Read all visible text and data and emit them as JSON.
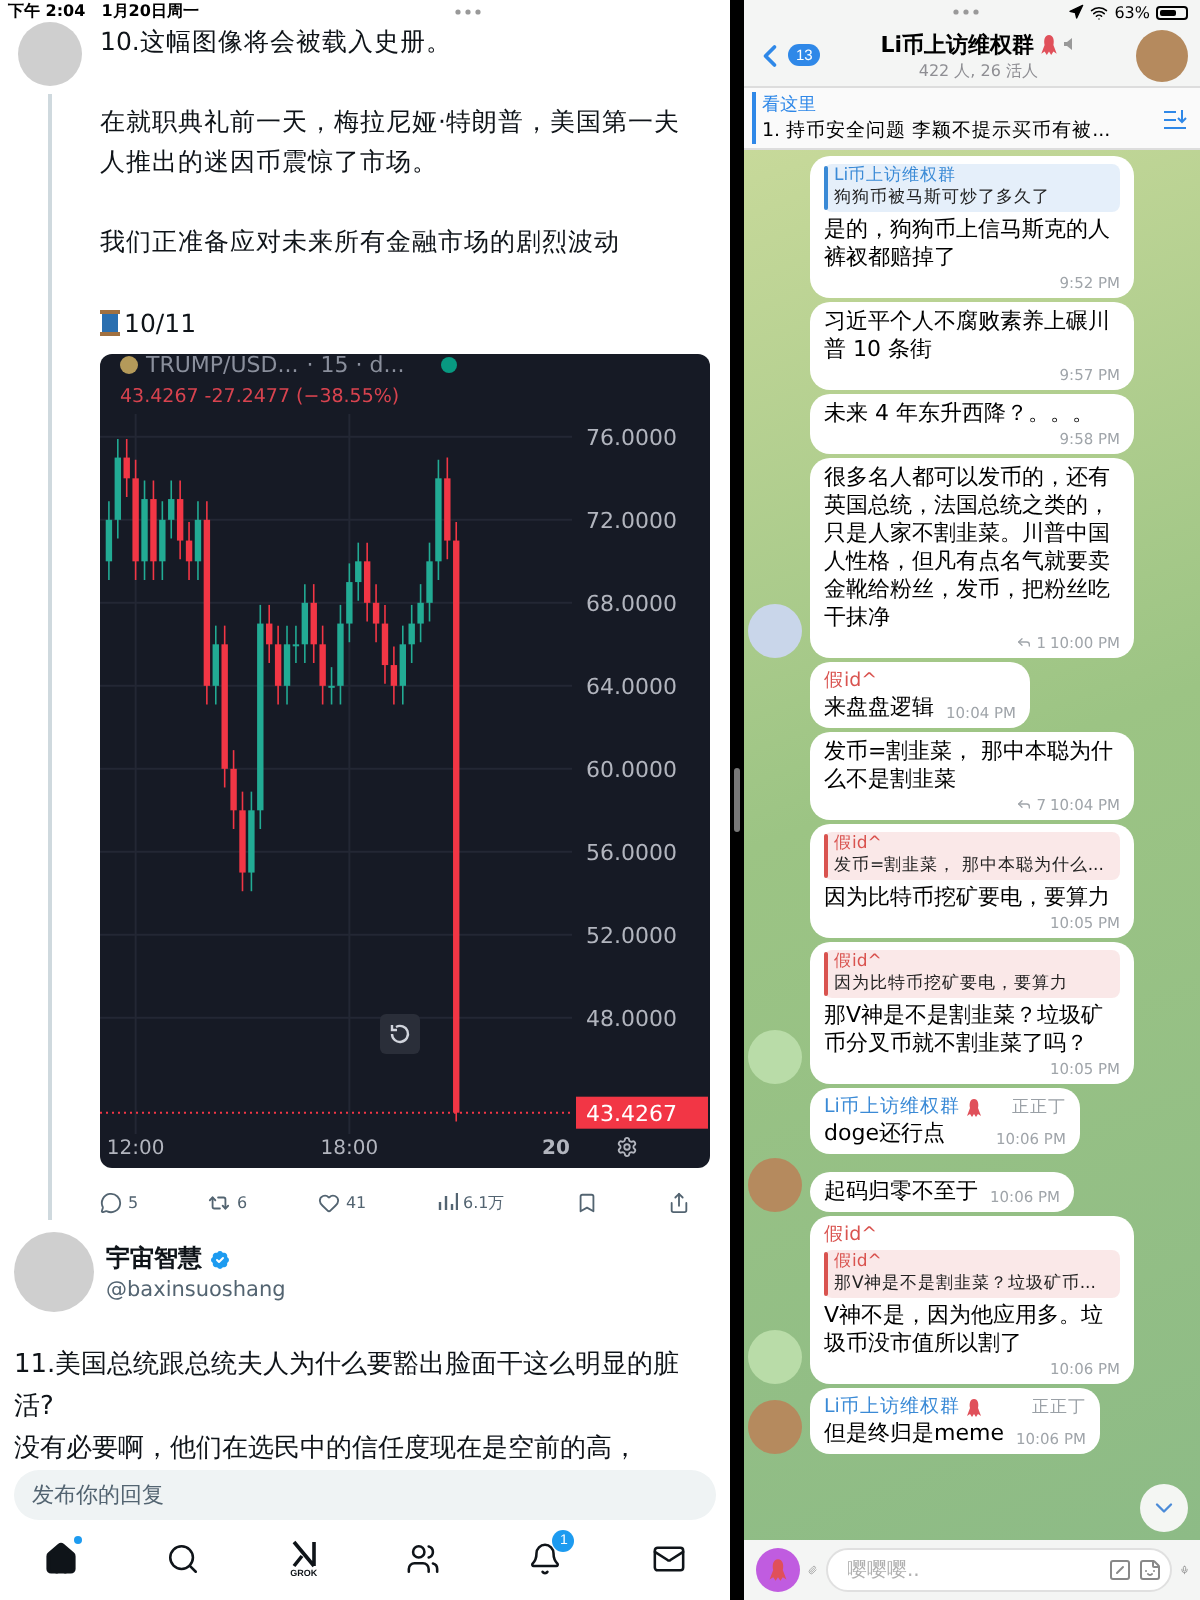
{
  "status_bar": {
    "time": "下午 2:04",
    "date": "1月20日周一",
    "battery": "63%"
  },
  "tweet": {
    "paragraphs": [
      "10.这幅图像将会被载入史册。",
      "在就职典礼前一天，梅拉尼娅·特朗普，美国第一夫人推出的迷因币震惊了市场。",
      "我们正准备应对未来所有金融市场的剧烈波动"
    ],
    "thread_counter": "10/11",
    "price_chart": {
      "symbol": "TRUMP/USD...",
      "interval": "· 15 · d...",
      "quote": "43.4267  -27.2477 (−38.55%)",
      "last_price": "43.4267",
      "date_label": "20",
      "chart_data": {
        "type": "candlestick",
        "x": [
          11.25,
          11.5,
          11.75,
          12,
          12.25,
          12.5,
          12.75,
          13,
          13.25,
          13.5,
          13.75,
          14,
          14.25,
          14.5,
          14.75,
          15,
          15.25,
          15.5,
          15.75,
          16,
          16.25,
          16.5,
          16.75,
          17,
          17.25,
          17.5,
          17.75,
          18,
          18.25,
          18.5,
          18.75,
          19,
          19.25,
          19.5,
          19.75,
          20,
          20.25,
          20.5,
          20.75,
          21
        ],
        "xlim": [
          11,
          24.25
        ],
        "ylim": [
          42.4,
          77.1
        ],
        "grid": true,
        "ref_lines": [
          {
            "axis": "y",
            "value": 43.4267,
            "color": "#f23645"
          }
        ],
        "ohlc": [
          [
            70,
            72.9,
            69.1,
            72
          ],
          [
            72,
            75.9,
            71.1,
            75
          ],
          [
            75,
            75.9,
            73.1,
            74
          ],
          [
            74,
            74.9,
            69.1,
            70
          ],
          [
            70,
            73.9,
            69.1,
            73
          ],
          [
            73,
            73.9,
            69.1,
            70
          ],
          [
            70,
            72.9,
            69.1,
            72
          ],
          [
            72,
            73.9,
            71.1,
            73
          ],
          [
            73,
            73.9,
            70.1,
            71
          ],
          [
            71,
            71.9,
            69.1,
            70
          ],
          [
            70,
            72.9,
            69.1,
            72
          ],
          [
            72,
            72.9,
            63.1,
            64
          ],
          [
            64,
            66.9,
            63.1,
            66
          ],
          [
            66,
            66.9,
            59.1,
            60
          ],
          [
            60,
            60.9,
            57.1,
            58
          ],
          [
            58,
            58.9,
            54.1,
            55
          ],
          [
            55,
            58.9,
            54.1,
            58
          ],
          [
            58,
            67.9,
            57.1,
            67
          ],
          [
            67,
            67.9,
            65.1,
            66
          ],
          [
            66,
            66.9,
            63.1,
            64
          ],
          [
            64,
            66.9,
            63.1,
            66
          ],
          [
            66,
            66.9,
            65.1,
            66
          ],
          [
            66,
            68.9,
            65.1,
            68
          ],
          [
            68,
            68.9,
            65.1,
            66
          ],
          [
            66,
            66.9,
            63.1,
            64
          ],
          [
            64,
            64.9,
            63.1,
            64
          ],
          [
            64,
            67.9,
            63.1,
            67
          ],
          [
            67,
            69.9,
            66.1,
            69
          ],
          [
            69,
            70.9,
            68.1,
            70
          ],
          [
            70,
            70.9,
            67.1,
            68
          ],
          [
            68,
            68.9,
            66.1,
            67
          ],
          [
            67,
            67.9,
            64.1,
            65
          ],
          [
            65,
            65.9,
            63.1,
            64
          ],
          [
            64,
            66.9,
            63.1,
            66
          ],
          [
            66,
            67.9,
            65.1,
            67
          ],
          [
            67,
            68.9,
            66.1,
            68
          ],
          [
            68,
            70.9,
            67.1,
            70
          ],
          [
            70,
            74.9,
            69.1,
            74
          ],
          [
            74,
            75,
            70.1,
            71
          ],
          [
            71,
            71.9,
            43,
            43.4267
          ]
        ],
        "yticks": [
          {
            "value": 76,
            "label": "76.0000"
          },
          {
            "value": 72,
            "label": "72.0000"
          },
          {
            "value": 68,
            "label": "68.0000"
          },
          {
            "value": 64,
            "label": "64.0000"
          },
          {
            "value": 60,
            "label": "60.0000"
          },
          {
            "value": 56,
            "label": "56.0000"
          },
          {
            "value": 52,
            "label": "52.0000"
          },
          {
            "value": 48,
            "label": "48.0000"
          }
        ],
        "xticks": [
          {
            "value": 12,
            "label": "12:00"
          },
          {
            "value": 18,
            "label": "18:00"
          }
        ]
      }
    },
    "actions": [
      {
        "kind": "reply",
        "count": "5"
      },
      {
        "kind": "repost",
        "count": "6"
      },
      {
        "kind": "like",
        "count": "41"
      },
      {
        "kind": "views",
        "count": "6.1万"
      },
      {
        "kind": "bookmark"
      },
      {
        "kind": "share"
      }
    ]
  },
  "next_tweet": {
    "name": "宇宙智慧",
    "verified": true,
    "handle": "@baxinsuoshang",
    "paragraphs": [
      "11.美国总统跟总统夫人为什么要豁出脸面干这么明显的脏活?",
      "没有必要啊，他们在选民中的信任度现在是空前的高，"
    ]
  },
  "reply_field": {
    "placeholder": "发布你的回复"
  },
  "bottom_nav": [
    {
      "kind": "home",
      "selected": true,
      "dot": true
    },
    {
      "kind": "search",
      "selected": false
    },
    {
      "kind": "grok",
      "selected": false,
      "label": "GROK"
    },
    {
      "kind": "communities",
      "selected": false
    },
    {
      "kind": "notifications",
      "selected": false,
      "badge": "1"
    },
    {
      "kind": "messages",
      "selected": false
    }
  ],
  "chat": {
    "header": {
      "back_count": "13",
      "title": "Li币上访维权群",
      "subtitle": "422 人, 26 活人"
    },
    "pinned": {
      "title": "看这里",
      "text": "1. 持币安全问题 李颖不提示买币有被..."
    },
    "messages": [
      {
        "quote": {
          "author": "Li币上访维权群",
          "color": "#3a8ad6",
          "text": "狗狗币被马斯可炒了多久了"
        },
        "text": "是的，狗狗币上信马斯克的人裤衩都赔掉了",
        "time": "9:52 PM"
      },
      {
        "text": "习近平个人不腐败素养上碾川普 10 条街",
        "time": "9:57 PM"
      },
      {
        "text": "未来 4 年东升西降？。。。",
        "time": "9:58 PM"
      },
      {
        "text": "很多名人都可以发币的，还有英国总统，法国总统之类的，只是人家不割韭菜。川普中国人性格，但凡有点名气就要卖金靴给粉丝，发币，把粉丝吃干抹净",
        "replies": "1",
        "time": "10:00 PM",
        "avatar": {
          "color": "#c9d6ea"
        }
      },
      {
        "sender": {
          "name": "假id^",
          "color": "#d9534f",
          "badge": false
        },
        "text": "来盘盘逻辑",
        "time": "10:04 PM"
      },
      {
        "text": "发币=割韭菜， 那中本聪为什么不是割韭菜",
        "replies": "7",
        "time": "10:04 PM"
      },
      {
        "quote": {
          "author": "假id^",
          "color": "#d9534f",
          "text": "发币=割韭菜， 那中本聪为什么..."
        },
        "text": "因为比特币挖矿要电，要算力",
        "time": "10:05 PM"
      },
      {
        "quote": {
          "author": "假id^",
          "color": "#d9534f",
          "text": "因为比特币挖矿要电，要算力"
        },
        "text": "那V神是不是割韭菜？垃圾矿币分叉币就不割韭菜了吗？",
        "time": "10:05 PM",
        "avatar": {
          "color": "#b9dca8"
        }
      },
      {
        "sender": {
          "name": "Li币上访维权群",
          "color": "#3a8ad6",
          "badge": true,
          "admin_title": "正正丁"
        },
        "text": "doge还行点",
        "time": "10:06 PM"
      },
      {
        "text": "起码归零不至于",
        "time": "10:06 PM",
        "avatar": {
          "color": "#b58a5e"
        }
      },
      {
        "sender": {
          "name": "假id^",
          "color": "#d9534f",
          "badge": false
        },
        "quote": {
          "author": "假id^",
          "color": "#d9534f",
          "text": "那V神是不是割韭菜？垃圾矿币..."
        },
        "text": "V神不是，因为他应用多。垃圾币没市值所以割了",
        "time": "10:06 PM",
        "avatar": {
          "color": "#b9dca8"
        }
      },
      {
        "sender": {
          "name": "Li币上访维权群",
          "color": "#3a8ad6",
          "badge": true,
          "admin_title": "正正丁"
        },
        "text": "但是终归是meme",
        "time": "10:06 PM",
        "avatar": {
          "color": "#b58a5e"
        }
      }
    ],
    "composer": {
      "placeholder": "嘤嘤嘤.."
    }
  }
}
